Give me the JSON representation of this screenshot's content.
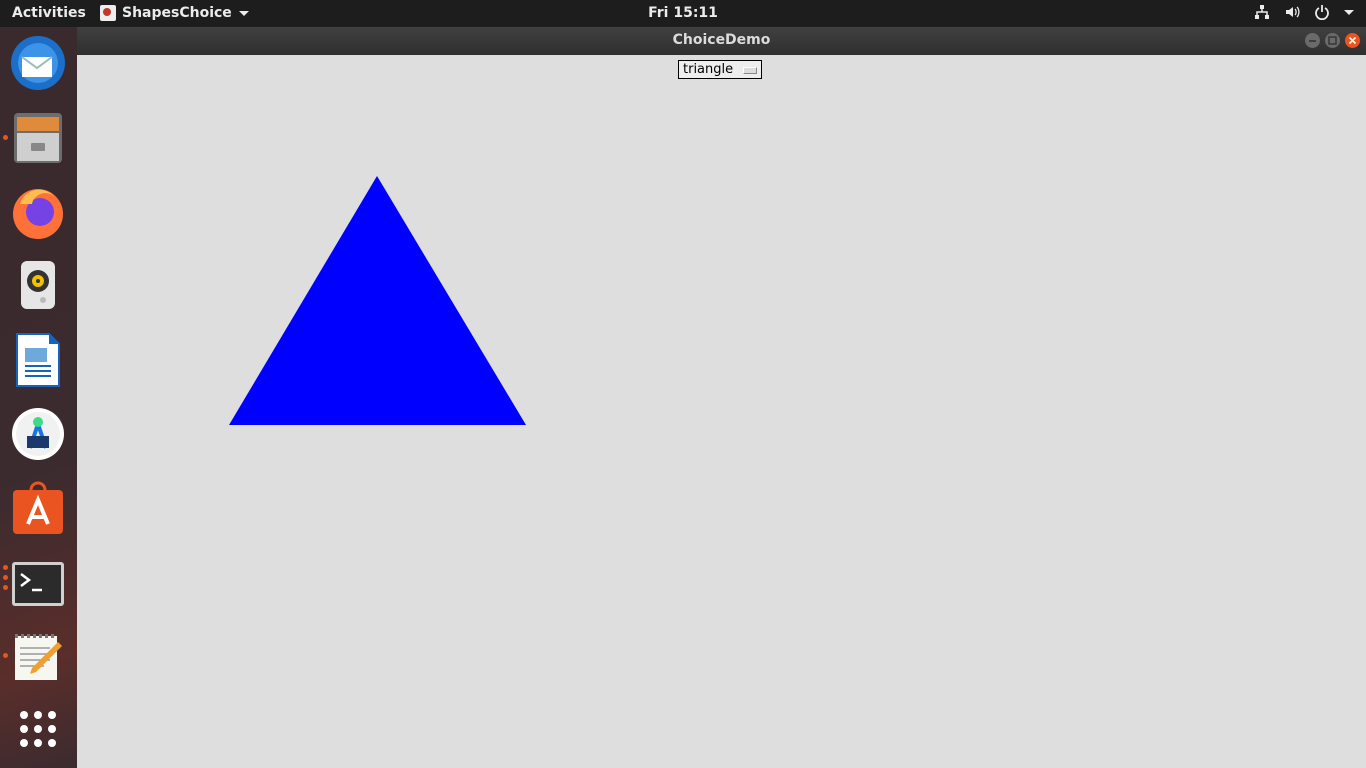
{
  "topbar": {
    "activities": "Activities",
    "app_name": "ShapesChoice",
    "clock": "Fri 15:11"
  },
  "dock": {
    "items": [
      {
        "name": "thunderbird-icon"
      },
      {
        "name": "files-icon",
        "running": true
      },
      {
        "name": "firefox-icon"
      },
      {
        "name": "rhythmbox-icon"
      },
      {
        "name": "libreoffice-writer-icon"
      },
      {
        "name": "android-studio-icon"
      },
      {
        "name": "ubuntu-software-icon"
      },
      {
        "name": "terminal-icon",
        "running": true
      },
      {
        "name": "text-editor-icon",
        "running": true
      },
      {
        "name": "show-applications-icon"
      }
    ]
  },
  "window": {
    "title": "ChoiceDemo",
    "choice": {
      "selected": "triangle"
    },
    "shape": {
      "type": "triangle",
      "color": "#0000ff"
    }
  },
  "colors": {
    "topbar_bg": "#1d1d1d",
    "canvas_bg": "#dedede",
    "accent": "#e95420"
  }
}
